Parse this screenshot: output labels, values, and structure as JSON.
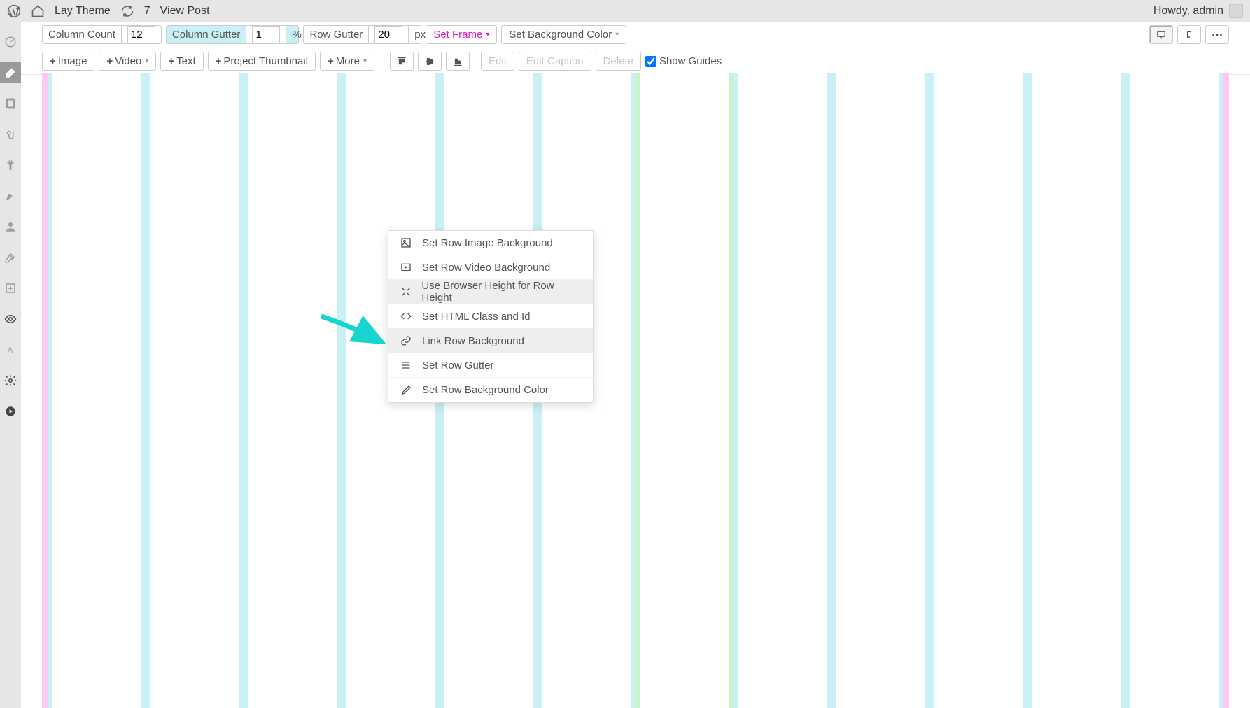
{
  "adminbar": {
    "site_title": "Lay Theme",
    "updates_count": "7",
    "view_post": "View Post",
    "howdy": "Howdy, admin"
  },
  "toolbar": {
    "column_count_label": "Column Count",
    "column_count_value": "12",
    "column_gutter_label": "Column Gutter",
    "column_gutter_value": "1",
    "column_gutter_unit": "%",
    "row_gutter_label": "Row Gutter",
    "row_gutter_value": "20",
    "row_gutter_unit": "px",
    "set_frame": "Set Frame",
    "set_bg_color": "Set Background Color",
    "add_image": "Image",
    "add_video": "Video",
    "add_text": "Text",
    "add_project_thumbnail": "Project Thumbnail",
    "add_more": "More",
    "edit": "Edit",
    "edit_caption": "Edit Caption",
    "delete": "Delete",
    "show_guides": "Show Guides"
  },
  "context_menu": {
    "items": [
      {
        "label": "Set Row Image Background"
      },
      {
        "label": "Set Row Video Background"
      },
      {
        "label": "Use Browser Height for Row Height"
      },
      {
        "label": "Set HTML Class and Id"
      },
      {
        "label": "Link Row Background"
      },
      {
        "label": "Set Row Gutter"
      },
      {
        "label": "Set Row Background Color"
      }
    ]
  }
}
